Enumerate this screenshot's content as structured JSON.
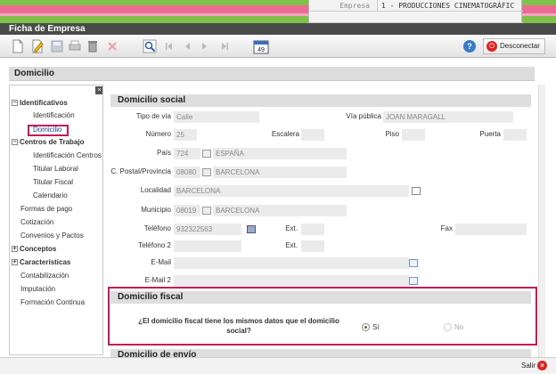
{
  "company_panel": {
    "label": "Empresa",
    "value": "1 - PRODUCCIONES CINEMATOGRÁFIC"
  },
  "window_title": "Ficha de Empresa",
  "toolbar": {
    "icons": [
      "new-icon",
      "edit-icon",
      "save-icon",
      "print-icon",
      "delete-icon",
      "cancel-icon",
      "search-icon",
      "first-icon",
      "prev-icon",
      "next-icon",
      "last-icon",
      "calendar-icon"
    ],
    "calendar_day": "49",
    "help_label": "?",
    "disconnect_label": "Desconectar"
  },
  "section_title": "Domicilio",
  "tree": {
    "items": [
      {
        "label": "Identificativos",
        "bold": true,
        "expander": "−"
      },
      {
        "label": "Identificación"
      },
      {
        "label": "Domicilio",
        "selected": true
      },
      {
        "label": "Centros de Trabajo",
        "bold": true,
        "expander": "−"
      },
      {
        "label": "Identificación Centros"
      },
      {
        "label": "Titular Laboral"
      },
      {
        "label": "Titular Fiscal"
      },
      {
        "label": "Calendario"
      },
      {
        "label": "Formas de pago"
      },
      {
        "label": "Cotización"
      },
      {
        "label": "Convenios y Pactos"
      },
      {
        "label": "Conceptos",
        "bold": true,
        "expander": "+"
      },
      {
        "label": "Características",
        "bold": true,
        "expander": "+"
      },
      {
        "label": "Contabilización"
      },
      {
        "label": "Imputación"
      },
      {
        "label": "Formación Continua"
      }
    ],
    "close_label": "×"
  },
  "domicilio_social": {
    "title": "Domicilio social",
    "tipo_via": {
      "label": "Tipo de vía",
      "value": "Calle"
    },
    "via_publica": {
      "label": "Vía pública",
      "value": "JOAN MARAGALL"
    },
    "numero": {
      "label": "Número",
      "value": "25"
    },
    "escalera": {
      "label": "Escalera",
      "value": ""
    },
    "piso": {
      "label": "Piso",
      "value": ""
    },
    "puerta": {
      "label": "Puerta",
      "value": ""
    },
    "pais": {
      "label": "País",
      "code": "724",
      "name": "ESPAÑA"
    },
    "cp_provincia": {
      "label": "C. Postal/Provincia",
      "code": "08080",
      "name": "BARCELONA"
    },
    "localidad": {
      "label": "Localidad",
      "value": "BARCELONA"
    },
    "municipio": {
      "label": "Municipio",
      "code": "08019",
      "name": "BARCELONA"
    },
    "telefono": {
      "label": "Teléfono",
      "value": "932322563"
    },
    "ext1": {
      "label": "Ext.",
      "value": ""
    },
    "fax": {
      "label": "Fax",
      "value": ""
    },
    "telefono2": {
      "label": "Teléfono 2",
      "value": ""
    },
    "ext2": {
      "label": "Ext.",
      "value": ""
    },
    "email": {
      "label": "E-Mail",
      "value": ""
    },
    "email2": {
      "label": "E-Mail 2",
      "value": ""
    }
  },
  "domicilio_fiscal": {
    "title": "Domicilio fiscal",
    "question": "¿El domicilio fiscal tiene los mismos datos que el domicilio social?",
    "yes_label": "Sí",
    "no_label": "No",
    "selected": "Sí"
  },
  "next_section_title": "Domicilio de envío",
  "footer": {
    "exit_label": "Salir",
    "exit_icon": "×"
  },
  "colors": {
    "accent_pink": "#c2185b",
    "brand_green": "#6bb33c",
    "title_dark": "#4a4a4a"
  }
}
